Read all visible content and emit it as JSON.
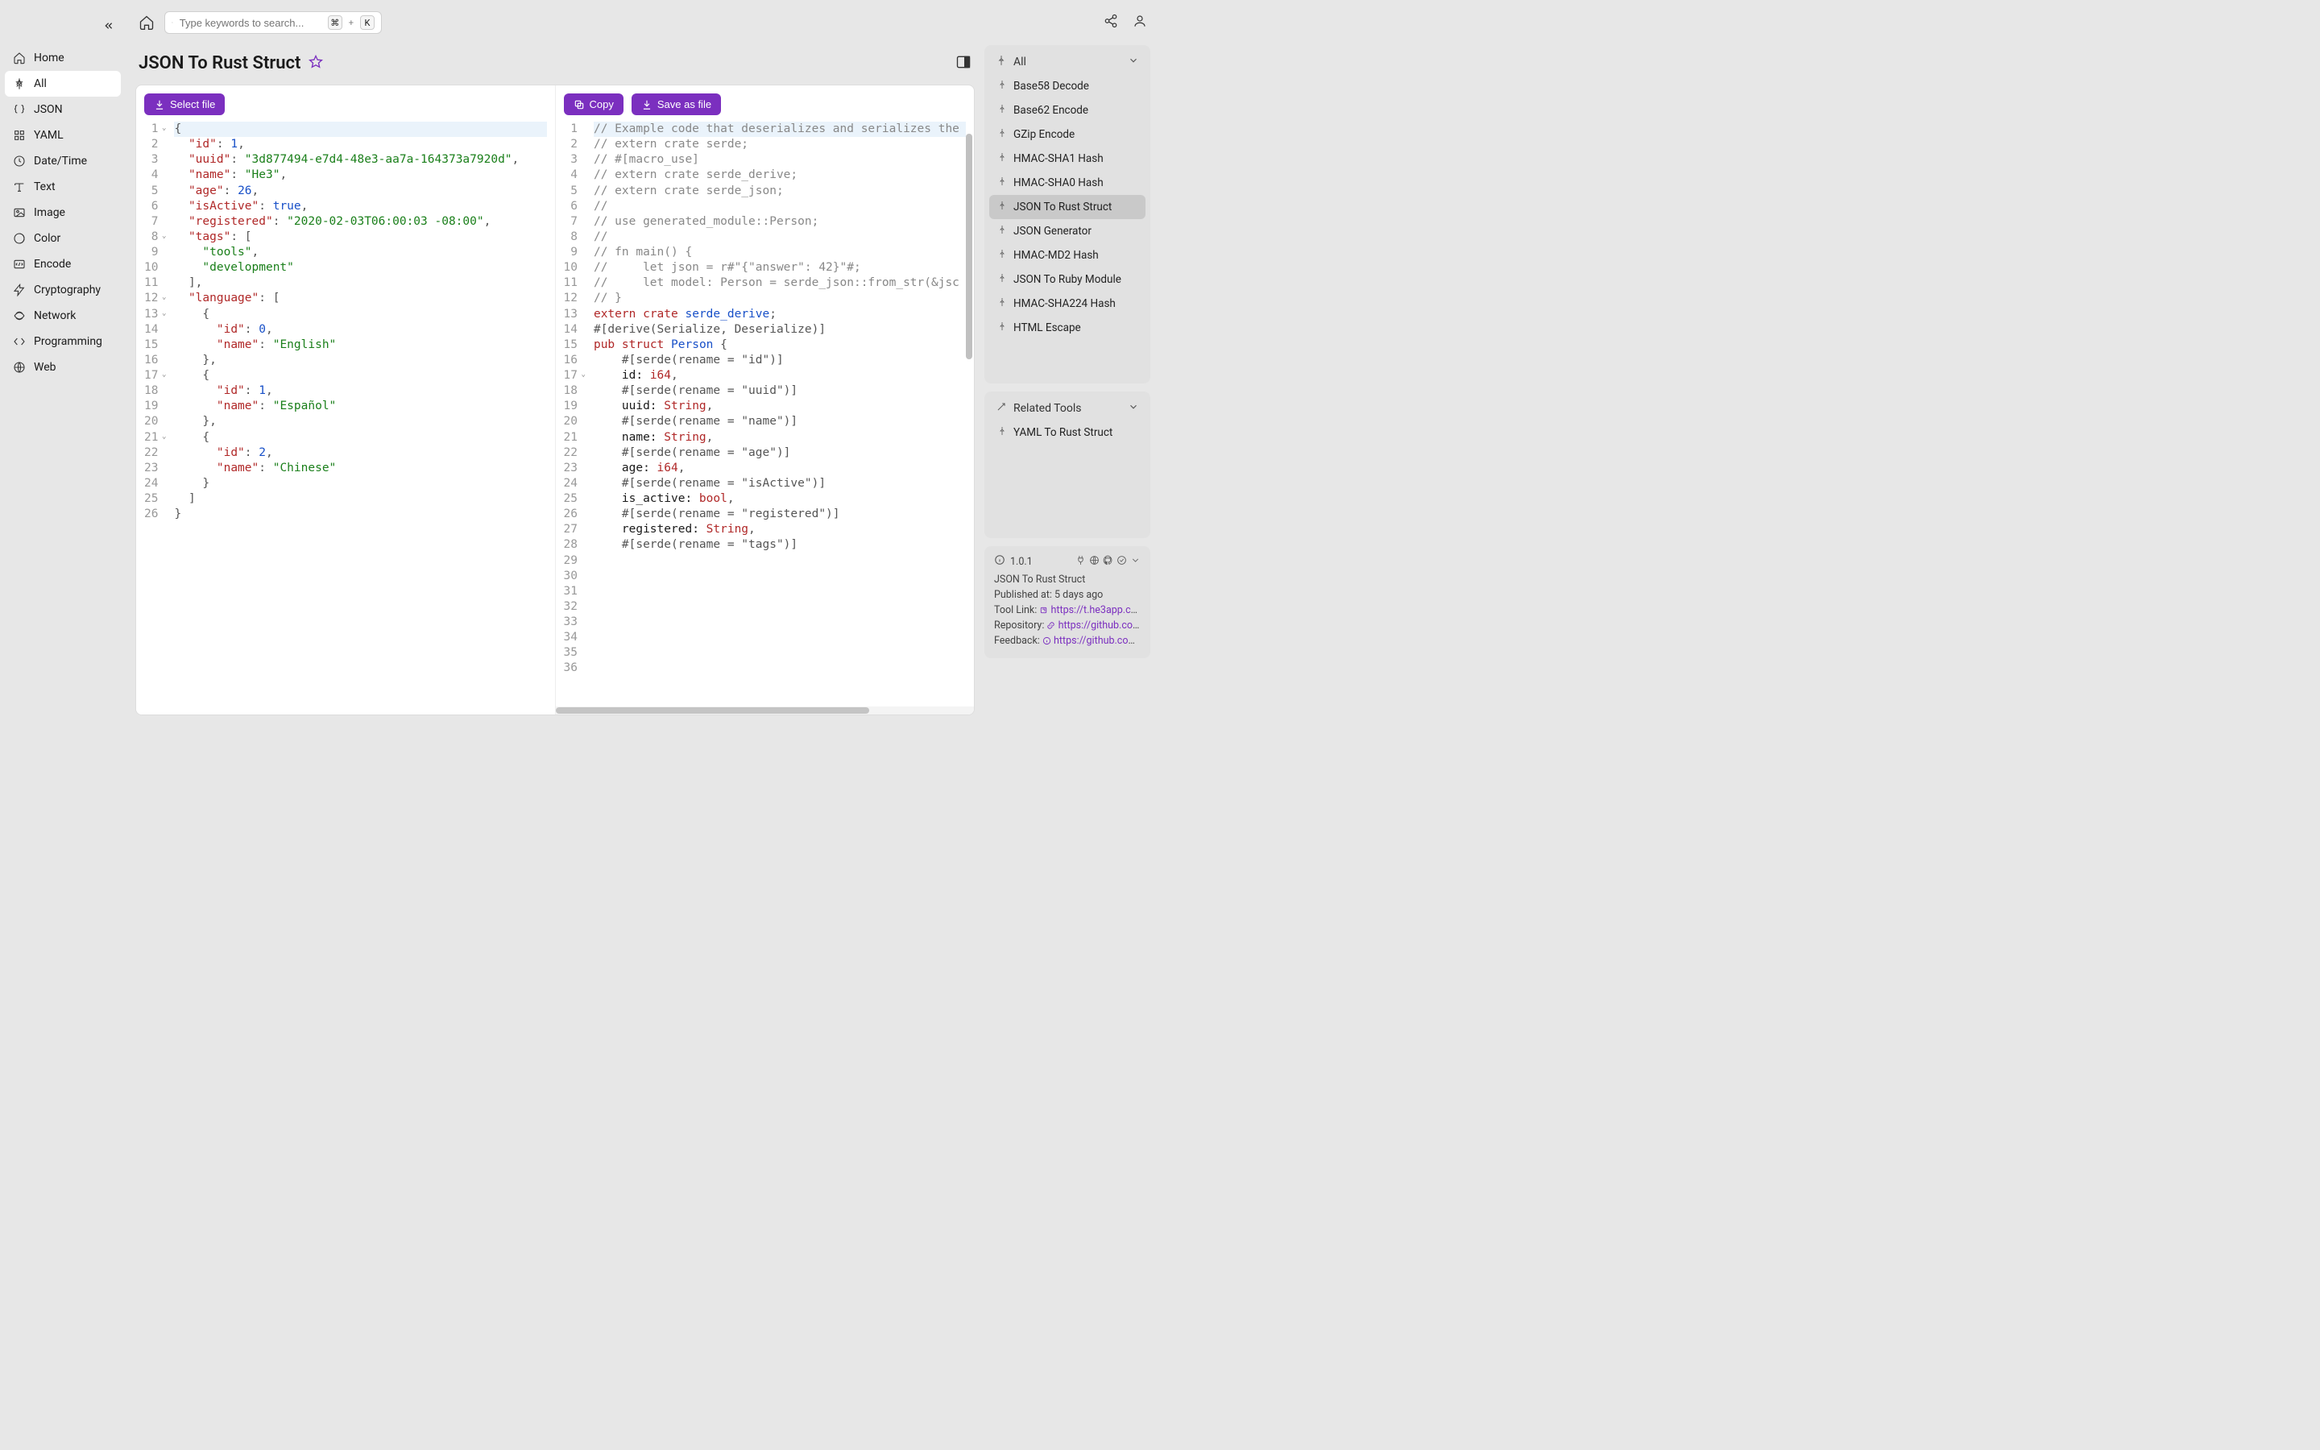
{
  "search": {
    "placeholder": "Type keywords to search...",
    "kbd1": "⌘",
    "kbd_plus": "+",
    "kbd2": "K"
  },
  "nav": [
    {
      "icon": "home",
      "label": "Home"
    },
    {
      "icon": "pin",
      "label": "All",
      "active": true
    },
    {
      "icon": "json",
      "label": "JSON"
    },
    {
      "icon": "yaml",
      "label": "YAML"
    },
    {
      "icon": "clock",
      "label": "Date/Time"
    },
    {
      "icon": "text",
      "label": "Text"
    },
    {
      "icon": "image",
      "label": "Image"
    },
    {
      "icon": "color",
      "label": "Color"
    },
    {
      "icon": "encode",
      "label": "Encode"
    },
    {
      "icon": "crypto",
      "label": "Cryptography"
    },
    {
      "icon": "network",
      "label": "Network"
    },
    {
      "icon": "prog",
      "label": "Programming"
    },
    {
      "icon": "web",
      "label": "Web"
    }
  ],
  "page_title": "JSON To Rust Struct",
  "buttons": {
    "select_file": "Select file",
    "copy": "Copy",
    "save_as_file": "Save as file"
  },
  "input_json": [
    {
      "n": 1,
      "fold": true,
      "hl": true,
      "tokens": [
        [
          "punc",
          "{"
        ]
      ]
    },
    {
      "n": 2,
      "tokens": [
        [
          "indent",
          "  "
        ],
        [
          "key",
          "\"id\""
        ],
        [
          "punc",
          ": "
        ],
        [
          "num",
          "1"
        ],
        [
          "punc",
          ","
        ]
      ]
    },
    {
      "n": 3,
      "tokens": [
        [
          "indent",
          "  "
        ],
        [
          "key",
          "\"uuid\""
        ],
        [
          "punc",
          ": "
        ],
        [
          "str",
          "\"3d877494-e7d4-48e3-aa7a-164373a7920d\""
        ],
        [
          "punc",
          ","
        ]
      ]
    },
    {
      "n": 4,
      "tokens": [
        [
          "indent",
          "  "
        ],
        [
          "key",
          "\"name\""
        ],
        [
          "punc",
          ": "
        ],
        [
          "str",
          "\"He3\""
        ],
        [
          "punc",
          ","
        ]
      ]
    },
    {
      "n": 5,
      "tokens": [
        [
          "indent",
          "  "
        ],
        [
          "key",
          "\"age\""
        ],
        [
          "punc",
          ": "
        ],
        [
          "num",
          "26"
        ],
        [
          "punc",
          ","
        ]
      ]
    },
    {
      "n": 6,
      "tokens": [
        [
          "indent",
          "  "
        ],
        [
          "key",
          "\"isActive\""
        ],
        [
          "punc",
          ": "
        ],
        [
          "bool",
          "true"
        ],
        [
          "punc",
          ","
        ]
      ]
    },
    {
      "n": 7,
      "tokens": [
        [
          "indent",
          "  "
        ],
        [
          "key",
          "\"registered\""
        ],
        [
          "punc",
          ": "
        ],
        [
          "str",
          "\"2020-02-03T06:00:03 -08:00\""
        ],
        [
          "punc",
          ","
        ]
      ]
    },
    {
      "n": 8,
      "fold": true,
      "tokens": [
        [
          "indent",
          "  "
        ],
        [
          "key",
          "\"tags\""
        ],
        [
          "punc",
          ": ["
        ]
      ]
    },
    {
      "n": 9,
      "tokens": [
        [
          "indent",
          "    "
        ],
        [
          "str",
          "\"tools\""
        ],
        [
          "punc",
          ","
        ]
      ]
    },
    {
      "n": 10,
      "tokens": [
        [
          "indent",
          "    "
        ],
        [
          "str",
          "\"development\""
        ]
      ]
    },
    {
      "n": 11,
      "tokens": [
        [
          "indent",
          "  "
        ],
        [
          "punc",
          "],"
        ]
      ]
    },
    {
      "n": 12,
      "fold": true,
      "tokens": [
        [
          "indent",
          "  "
        ],
        [
          "key",
          "\"language\""
        ],
        [
          "punc",
          ": ["
        ]
      ]
    },
    {
      "n": 13,
      "fold": true,
      "tokens": [
        [
          "indent",
          "    "
        ],
        [
          "punc",
          "{"
        ]
      ]
    },
    {
      "n": 14,
      "tokens": [
        [
          "indent",
          "      "
        ],
        [
          "key",
          "\"id\""
        ],
        [
          "punc",
          ": "
        ],
        [
          "num",
          "0"
        ],
        [
          "punc",
          ","
        ]
      ]
    },
    {
      "n": 15,
      "tokens": [
        [
          "indent",
          "      "
        ],
        [
          "key",
          "\"name\""
        ],
        [
          "punc",
          ": "
        ],
        [
          "str",
          "\"English\""
        ]
      ]
    },
    {
      "n": 16,
      "tokens": [
        [
          "indent",
          "    "
        ],
        [
          "punc",
          "},"
        ]
      ]
    },
    {
      "n": 17,
      "fold": true,
      "tokens": [
        [
          "indent",
          "    "
        ],
        [
          "punc",
          "{"
        ]
      ]
    },
    {
      "n": 18,
      "tokens": [
        [
          "indent",
          "      "
        ],
        [
          "key",
          "\"id\""
        ],
        [
          "punc",
          ": "
        ],
        [
          "num",
          "1"
        ],
        [
          "punc",
          ","
        ]
      ]
    },
    {
      "n": 19,
      "tokens": [
        [
          "indent",
          "      "
        ],
        [
          "key",
          "\"name\""
        ],
        [
          "punc",
          ": "
        ],
        [
          "str",
          "\"Español\""
        ]
      ]
    },
    {
      "n": 20,
      "tokens": [
        [
          "indent",
          "    "
        ],
        [
          "punc",
          "},"
        ]
      ]
    },
    {
      "n": 21,
      "fold": true,
      "tokens": [
        [
          "indent",
          "    "
        ],
        [
          "punc",
          "{"
        ]
      ]
    },
    {
      "n": 22,
      "tokens": [
        [
          "indent",
          "      "
        ],
        [
          "key",
          "\"id\""
        ],
        [
          "punc",
          ": "
        ],
        [
          "num",
          "2"
        ],
        [
          "punc",
          ","
        ]
      ]
    },
    {
      "n": 23,
      "tokens": [
        [
          "indent",
          "      "
        ],
        [
          "key",
          "\"name\""
        ],
        [
          "punc",
          ": "
        ],
        [
          "str",
          "\"Chinese\""
        ]
      ]
    },
    {
      "n": 24,
      "tokens": [
        [
          "indent",
          "    "
        ],
        [
          "punc",
          "}"
        ]
      ]
    },
    {
      "n": 25,
      "tokens": [
        [
          "indent",
          "  "
        ],
        [
          "punc",
          "]"
        ]
      ]
    },
    {
      "n": 26,
      "tokens": [
        [
          "punc",
          "}"
        ]
      ]
    }
  ],
  "output_code": [
    {
      "n": 1,
      "hl": true,
      "tokens": [
        [
          "comment",
          "// Example code that deserializes and serializes the"
        ]
      ]
    },
    {
      "n": 2,
      "tokens": [
        [
          "comment",
          "// extern crate serde;"
        ]
      ]
    },
    {
      "n": 3,
      "tokens": [
        [
          "comment",
          "// #[macro_use]"
        ]
      ]
    },
    {
      "n": 4,
      "tokens": [
        [
          "comment",
          "// extern crate serde_derive;"
        ]
      ]
    },
    {
      "n": 5,
      "tokens": [
        [
          "comment",
          "// extern crate serde_json;"
        ]
      ]
    },
    {
      "n": 6,
      "tokens": [
        [
          "comment",
          "//"
        ]
      ]
    },
    {
      "n": 7,
      "tokens": [
        [
          "comment",
          "// use generated_module::Person;"
        ]
      ]
    },
    {
      "n": 8,
      "tokens": [
        [
          "comment",
          "//"
        ]
      ]
    },
    {
      "n": 9,
      "tokens": [
        [
          "comment",
          "// fn main() {"
        ]
      ]
    },
    {
      "n": 10,
      "tokens": [
        [
          "comment",
          "//     let json = r#\"{\"answer\": 42}\"#;"
        ]
      ]
    },
    {
      "n": 11,
      "tokens": [
        [
          "comment",
          "//     let model: Person = serde_json::from_str(&jsc"
        ]
      ]
    },
    {
      "n": 12,
      "tokens": [
        [
          "comment",
          "// }"
        ]
      ]
    },
    {
      "n": 13,
      "tokens": [
        [
          "plain",
          ""
        ]
      ]
    },
    {
      "n": 14,
      "tokens": [
        [
          "kw",
          "extern"
        ],
        [
          "plain",
          " "
        ],
        [
          "kw",
          "crate"
        ],
        [
          "plain",
          " "
        ],
        [
          "fn",
          "serde_derive"
        ],
        [
          "punc",
          ";"
        ]
      ]
    },
    {
      "n": 15,
      "tokens": [
        [
          "plain",
          ""
        ]
      ]
    },
    {
      "n": 16,
      "tokens": [
        [
          "attr",
          "#[derive(Serialize, Deserialize)]"
        ]
      ]
    },
    {
      "n": 17,
      "fold": true,
      "tokens": [
        [
          "kw",
          "pub"
        ],
        [
          "plain",
          " "
        ],
        [
          "kw",
          "struct"
        ],
        [
          "plain",
          " "
        ],
        [
          "fn",
          "Person"
        ],
        [
          "plain",
          " "
        ],
        [
          "punc",
          "{"
        ]
      ]
    },
    {
      "n": 18,
      "tokens": [
        [
          "indent",
          "    "
        ],
        [
          "attr",
          "#[serde(rename = \"id\")]"
        ]
      ]
    },
    {
      "n": 19,
      "tokens": [
        [
          "indent",
          "    "
        ],
        [
          "plain",
          "id: "
        ],
        [
          "type",
          "i64"
        ],
        [
          "punc",
          ","
        ]
      ]
    },
    {
      "n": 20,
      "tokens": [
        [
          "plain",
          ""
        ]
      ]
    },
    {
      "n": 21,
      "tokens": [
        [
          "indent",
          "    "
        ],
        [
          "attr",
          "#[serde(rename = \"uuid\")]"
        ]
      ]
    },
    {
      "n": 22,
      "tokens": [
        [
          "indent",
          "    "
        ],
        [
          "plain",
          "uuid: "
        ],
        [
          "type",
          "String"
        ],
        [
          "punc",
          ","
        ]
      ]
    },
    {
      "n": 23,
      "tokens": [
        [
          "plain",
          ""
        ]
      ]
    },
    {
      "n": 24,
      "tokens": [
        [
          "indent",
          "    "
        ],
        [
          "attr",
          "#[serde(rename = \"name\")]"
        ]
      ]
    },
    {
      "n": 25,
      "tokens": [
        [
          "indent",
          "    "
        ],
        [
          "plain",
          "name: "
        ],
        [
          "type",
          "String"
        ],
        [
          "punc",
          ","
        ]
      ]
    },
    {
      "n": 26,
      "tokens": [
        [
          "plain",
          ""
        ]
      ]
    },
    {
      "n": 27,
      "tokens": [
        [
          "indent",
          "    "
        ],
        [
          "attr",
          "#[serde(rename = \"age\")]"
        ]
      ]
    },
    {
      "n": 28,
      "tokens": [
        [
          "indent",
          "    "
        ],
        [
          "plain",
          "age: "
        ],
        [
          "type",
          "i64"
        ],
        [
          "punc",
          ","
        ]
      ]
    },
    {
      "n": 29,
      "tokens": [
        [
          "plain",
          ""
        ]
      ]
    },
    {
      "n": 30,
      "tokens": [
        [
          "indent",
          "    "
        ],
        [
          "attr",
          "#[serde(rename = \"isActive\")]"
        ]
      ]
    },
    {
      "n": 31,
      "tokens": [
        [
          "indent",
          "    "
        ],
        [
          "plain",
          "is_active: "
        ],
        [
          "type",
          "bool"
        ],
        [
          "punc",
          ","
        ]
      ]
    },
    {
      "n": 32,
      "tokens": [
        [
          "plain",
          ""
        ]
      ]
    },
    {
      "n": 33,
      "tokens": [
        [
          "indent",
          "    "
        ],
        [
          "attr",
          "#[serde(rename = \"registered\")]"
        ]
      ]
    },
    {
      "n": 34,
      "tokens": [
        [
          "indent",
          "    "
        ],
        [
          "plain",
          "registered: "
        ],
        [
          "type",
          "String"
        ],
        [
          "punc",
          ","
        ]
      ]
    },
    {
      "n": 35,
      "tokens": [
        [
          "plain",
          ""
        ]
      ]
    },
    {
      "n": 36,
      "tokens": [
        [
          "indent",
          "    "
        ],
        [
          "attr",
          "#[serde(rename = \"tags\")]"
        ]
      ]
    }
  ],
  "right": {
    "all_label": "All",
    "tools": [
      "Base58 Decode",
      "Base62 Encode",
      "GZip Encode",
      "HMAC-SHA1 Hash",
      "HMAC-SHA0 Hash",
      "JSON To Rust Struct",
      "JSON Generator",
      "HMAC-MD2 Hash",
      "JSON To Ruby Module",
      "HMAC-SHA224 Hash",
      "HTML Escape"
    ],
    "tools_active_index": 5,
    "related_label": "Related Tools",
    "related": [
      "YAML To Rust Struct"
    ],
    "info": {
      "version": "1.0.1",
      "name": "JSON To Rust Struct",
      "published_label": "Published at:",
      "published_value": "5 days ago",
      "tool_link_label": "Tool Link:",
      "tool_link_value": "https://t.he3app.co…",
      "repo_label": "Repository:",
      "repo_value": "https://github.com…",
      "feedback_label": "Feedback:",
      "feedback_value": "https://github.com/…"
    }
  }
}
